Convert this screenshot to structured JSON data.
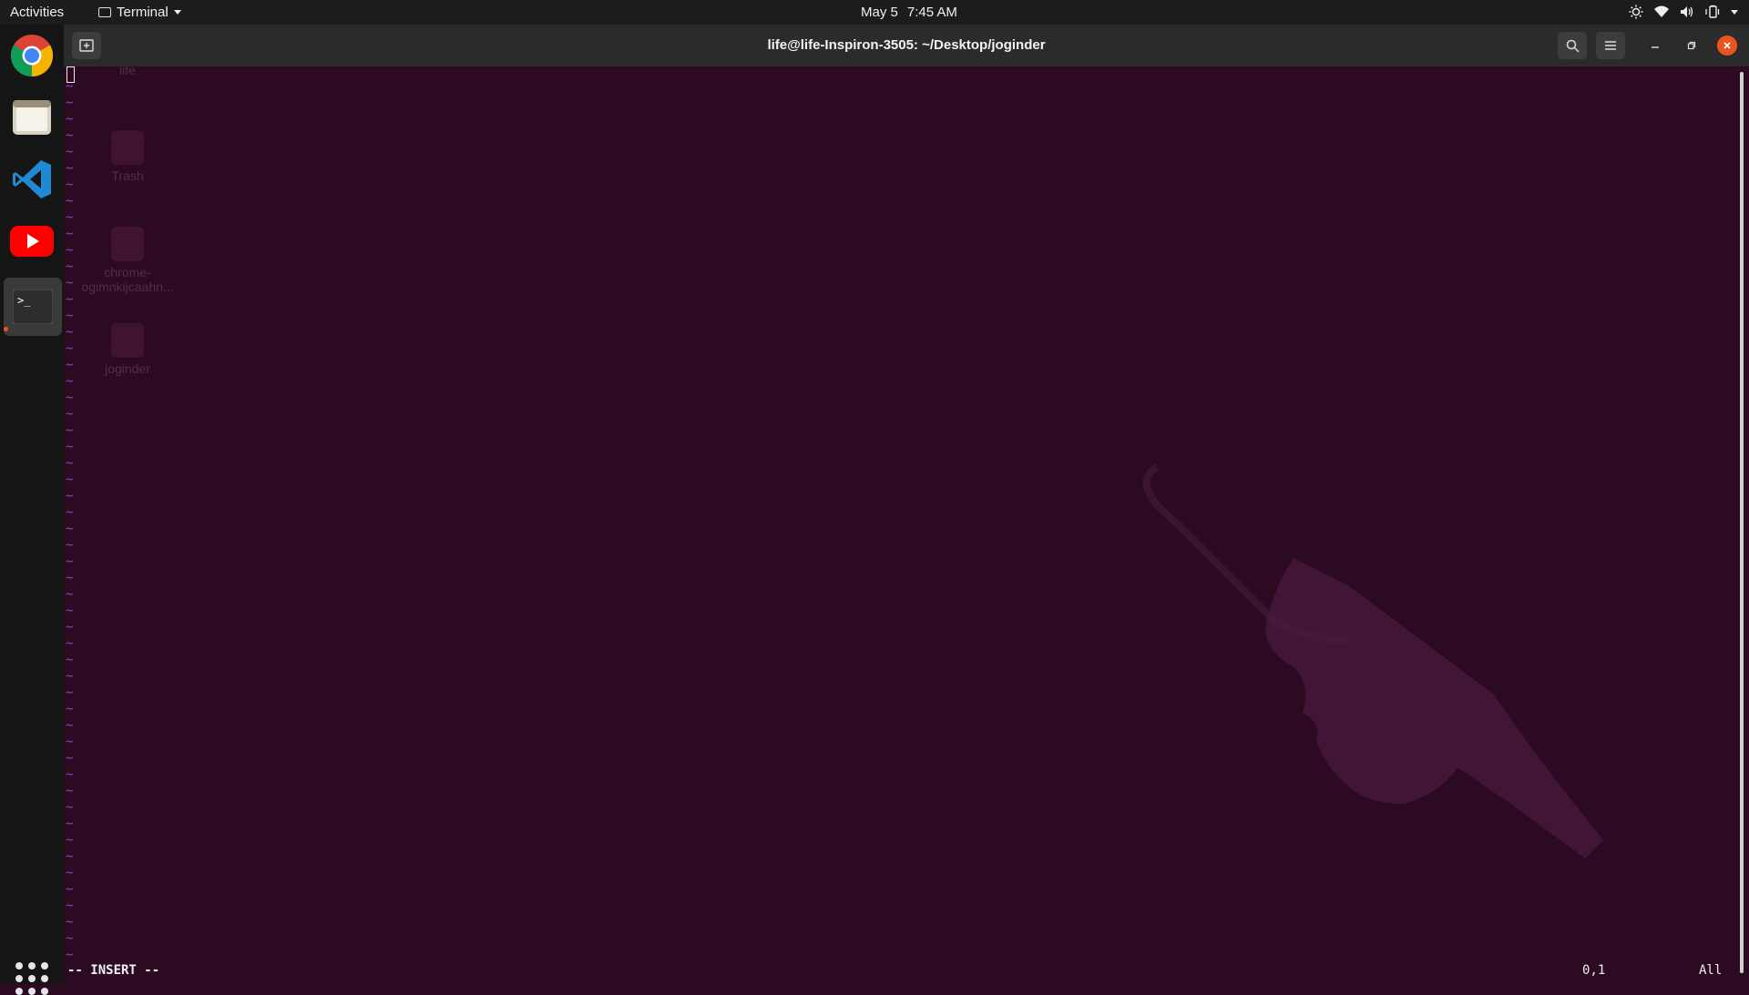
{
  "topbar": {
    "activities": "Activities",
    "app_menu": "Terminal",
    "date": "May 5",
    "time": "7:45 AM"
  },
  "dock": {
    "items": [
      "chrome-icon",
      "files-icon",
      "vscode-icon",
      "youtube-icon",
      "terminal-icon"
    ],
    "active": "terminal-icon"
  },
  "window": {
    "title": "life@life-Inspiron-3505: ~/Desktop/joginder"
  },
  "desktop_icons": [
    {
      "label": "life"
    },
    {
      "label": "Trash"
    },
    {
      "label": "chrome-"
    },
    {
      "label": "ogimnkijcaahn..."
    },
    {
      "label": "joginder"
    }
  ],
  "vim": {
    "tilde_char": "~",
    "mode": "-- INSERT --",
    "position": "0,1",
    "scroll": "All"
  },
  "colors": {
    "terminal_bg": "#2c0a22",
    "tilde": "#9a3fb0",
    "accent": "#e95420"
  }
}
